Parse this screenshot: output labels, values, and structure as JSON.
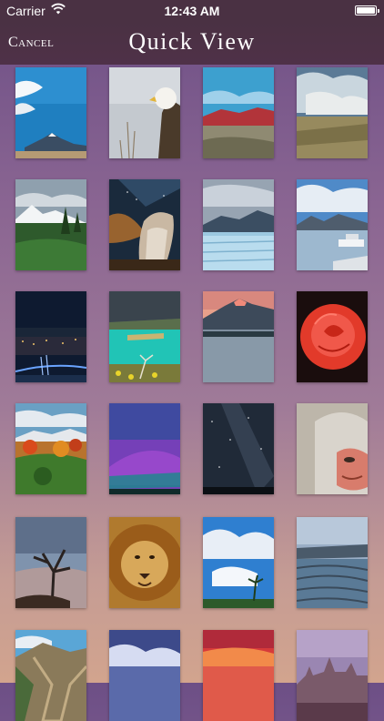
{
  "status_bar": {
    "carrier": "Carrier",
    "time": "12:43 AM"
  },
  "nav": {
    "cancel_label": "Cancel",
    "title": "Quick View"
  },
  "grid": {
    "columns": 4,
    "thumbnails": [
      {
        "name": "thumb-blue-sky-volcano"
      },
      {
        "name": "thumb-bald-eagle"
      },
      {
        "name": "thumb-red-rock-desert"
      },
      {
        "name": "thumb-clouded-plateau"
      },
      {
        "name": "thumb-snowy-mountain-forest"
      },
      {
        "name": "thumb-milky-way-rock"
      },
      {
        "name": "thumb-glacier"
      },
      {
        "name": "thumb-lake-boat"
      },
      {
        "name": "thumb-city-bridge-night"
      },
      {
        "name": "thumb-turquoise-lagoon"
      },
      {
        "name": "thumb-mountain-lake-sunset"
      },
      {
        "name": "thumb-red-rose"
      },
      {
        "name": "thumb-autumn-forest"
      },
      {
        "name": "thumb-aurora-sky"
      },
      {
        "name": "thumb-milky-way-night"
      },
      {
        "name": "thumb-baboon-face"
      },
      {
        "name": "thumb-dead-tree-storm"
      },
      {
        "name": "thumb-lion"
      },
      {
        "name": "thumb-palm-clouds"
      },
      {
        "name": "thumb-rice-terraces"
      },
      {
        "name": "thumb-cliffside"
      },
      {
        "name": "thumb-purple-clouds"
      },
      {
        "name": "thumb-red-sunset"
      },
      {
        "name": "thumb-parliament-building"
      }
    ]
  }
}
